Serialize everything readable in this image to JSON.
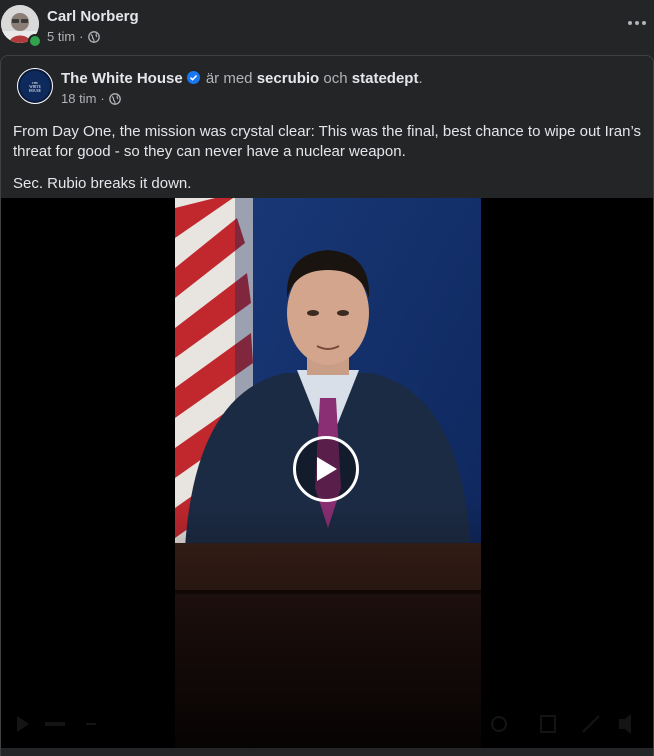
{
  "outer_post": {
    "author": "Carl Norberg",
    "time": "5 tim",
    "separator": "·",
    "privacy_icon": "globe-icon",
    "more_icon": "more-options-icon"
  },
  "shared_post": {
    "page_name": "The White House",
    "verified_icon": "verified-badge-icon",
    "with_text": "är med",
    "tagged_1": "secrubio",
    "and_text": "och",
    "tagged_2": "statedept",
    "end_punct": ".",
    "time": "18 tim",
    "separator": "·",
    "privacy_icon": "globe-icon",
    "text_p1": "From Day One, the mission was crystal clear: This was the final, best chance to wipe out Iran’s threat for good - so they can never have a nuclear weapon.",
    "text_p2": "Sec. Rubio breaks it down."
  },
  "video": {
    "play_icon": "play-icon",
    "control_icons": [
      "play-icon",
      "volume-icon",
      "settings-icon",
      "fullscreen-icon"
    ]
  },
  "colors": {
    "background": "#242526",
    "text_primary": "#e4e6eb",
    "text_secondary": "#b0b3b8",
    "verified": "#1877f2",
    "online": "#31a24c",
    "border": "#3e4042"
  }
}
